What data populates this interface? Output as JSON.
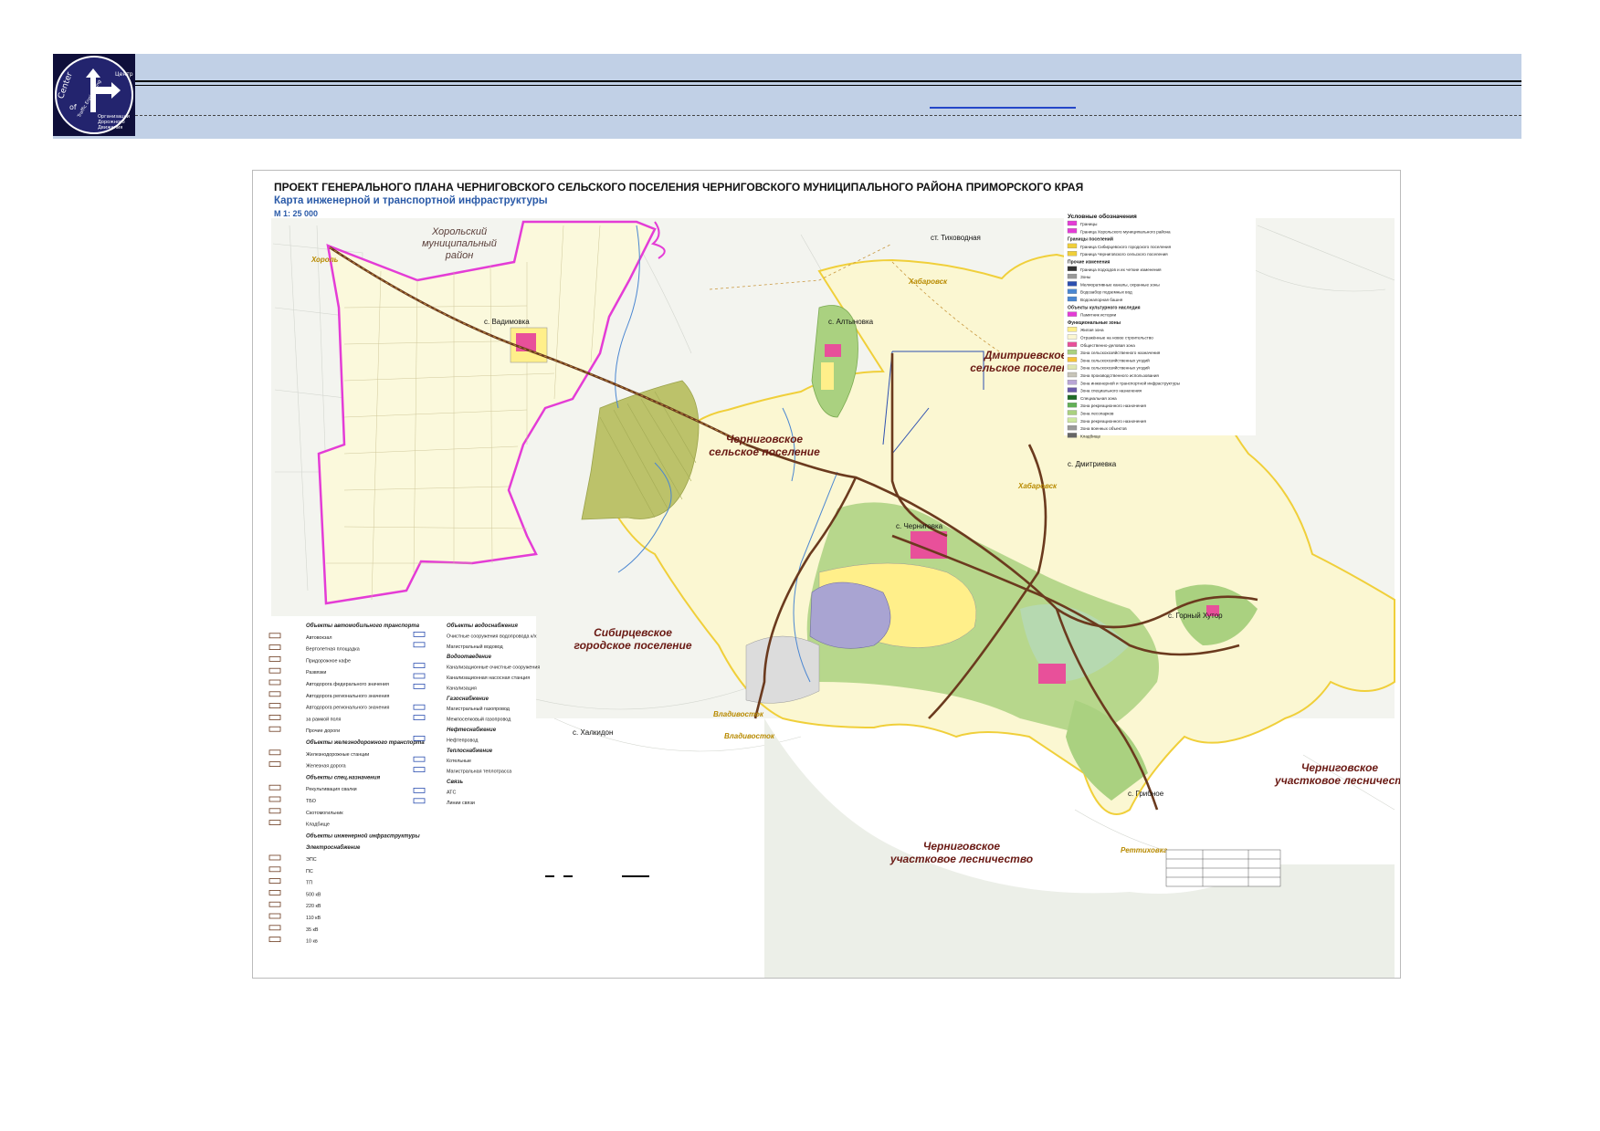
{
  "header": {
    "logo": {
      "text_center": "Center",
      "text_of": "of",
      "text_traffic": "Traffic Engineering",
      "text_centr": "Центр",
      "text_org1": "Организации",
      "text_org2": "Дорожного",
      "text_org3": "Движения"
    }
  },
  "map": {
    "title": "ПРОЕКТ ГЕНЕРАЛЬНОГО ПЛАНА ЧЕРНИГОВСКОГО СЕЛЬСКОГО ПОСЕЛЕНИЯ ЧЕРНИГОВСКОГО МУНИЦИПАЛЬНОГО РАЙОНА ПРИМОРСКОГО КРАЯ",
    "subtitle": "Карта инженерной и транспортной инфраструктуры",
    "scale": "М 1: 25 000",
    "regions": [
      {
        "id": "khorol",
        "lines": [
          "Хорольский",
          "муниципальный",
          "район"
        ]
      },
      {
        "id": "dmitr",
        "lines": [
          "Дмитриевское",
          "сельское поселение"
        ]
      },
      {
        "id": "chern",
        "lines": [
          "Черниговское",
          "сельское поселение"
        ]
      },
      {
        "id": "sibir",
        "lines": [
          "Сибирцевское",
          "городское поселение"
        ]
      },
      {
        "id": "lesn1",
        "lines": [
          "Черниговское",
          "участковое лесничество"
        ]
      },
      {
        "id": "lesn2",
        "lines": [
          "Черниговское",
          "участковое лесничест"
        ]
      }
    ],
    "settlements": {
      "vadimovka": "с. Вадимовка",
      "altynovka": "с. Алтыновка",
      "tikhovodnaya": "ст. Тиховодная",
      "chernigovka": "с. Черниговка",
      "dmitrievka": "с. Дмитриевка",
      "gorny": "с. Горный Хутор",
      "khalkidon": "с. Халкидон",
      "gribnoe": "с. Грибное"
    },
    "road_labels": {
      "khorol": "Хороль",
      "khab1": "Хабаровск",
      "khab2": "Хабаровск",
      "vlad1": "Владивосток",
      "vlad2": "Владивосток",
      "rettikhovka": "Реттиховка"
    },
    "legend_right": {
      "title": "Условные обозначения",
      "items": [
        "Границы",
        "Граница Хорольского муниципального района",
        "Границы поселений",
        "Граница Сибирцевского городского поселения",
        "Граница Черниговского сельского поселения",
        "Прочие изменения",
        "Граница подходов и их четкие изменения",
        "Зоны",
        "Мелиоративные каналы, охранные зоны",
        "Водозабор подземных вод",
        "Водонапорная башня",
        "Объекты культурного наследия",
        "Памятник истории",
        "Функциональные зоны",
        "Жилая зона",
        "Отражённые на новое строительство",
        "Общественно-деловая зона",
        "Зона сельскохозяйственного назначения",
        "Зона сельскохозяйственных угодий",
        "Зона сельскохозяйственных угодий",
        "Зона производственного использования",
        "Зона инженерной и транспортной инфраструктуры",
        "Зона специального назначения",
        "Специальная зона",
        "Зона рекреационного назначения",
        "Зона лесопарков",
        "Зона рекреационного назначения",
        "Зона военных объектов",
        "Кладбище"
      ]
    },
    "legend_left_col1": [
      {
        "h": true,
        "t": "Объекты автомобильного транспорта"
      },
      {
        "t": "Автовокзал"
      },
      {
        "t": "Вертолетная площадка"
      },
      {
        "t": "Придорожное кафе"
      },
      {
        "t": "Развязки"
      },
      {
        "t": "Автодорога федерального значения"
      },
      {
        "t": "Автодорога регионального значения"
      },
      {
        "t": "Автодорога регионального значения"
      },
      {
        "t": "за рамкой поля"
      },
      {
        "t": "Прочие дороги"
      },
      {
        "h": true,
        "t": "Объекты железнодорожного транспорта"
      },
      {
        "t": "Железнодорожные станции"
      },
      {
        "t": "Железная дорога"
      },
      {
        "h": true,
        "t": "Объекты спец.назначения"
      },
      {
        "t": "Рекультивация свалки"
      },
      {
        "t": "ТБО"
      },
      {
        "t": "Скотомогильник"
      },
      {
        "t": "Кладбище"
      },
      {
        "h": true,
        "t": "Объекты инженерной инфраструктуры"
      },
      {
        "h": true,
        "t": "Электроснабжение"
      },
      {
        "t": "ЭПС"
      },
      {
        "t": "ПС"
      },
      {
        "t": "ТП"
      },
      {
        "t": "500 кВ"
      },
      {
        "t": "220 кВ"
      },
      {
        "t": "110 кВ"
      },
      {
        "t": "35 кВ"
      },
      {
        "t": "10 кв"
      }
    ],
    "legend_left_col2": [
      {
        "h": true,
        "t": "Объекты водоснабжения"
      },
      {
        "t": "Очистные сооружения водопровода к/х"
      },
      {
        "t": "Магистральный водовод"
      },
      {
        "h": true,
        "t": "Водоотведение"
      },
      {
        "t": "Канализационные очистные сооружения"
      },
      {
        "t": "Канализационная насосная станция"
      },
      {
        "t": "Канализация"
      },
      {
        "h": true,
        "t": "Газоснабжение"
      },
      {
        "t": "Магистральный газопровод"
      },
      {
        "t": "Межпоселковый газопровод"
      },
      {
        "h": true,
        "t": "Нефтеснабжение"
      },
      {
        "t": "Нефтепровод"
      },
      {
        "h": true,
        "t": "Теплоснабжение"
      },
      {
        "t": "Котельные"
      },
      {
        "t": "Магистральная теплотрасса"
      },
      {
        "h": true,
        "t": "Связь"
      },
      {
        "t": "АТС"
      },
      {
        "t": "Линии связи"
      }
    ]
  },
  "colors": {
    "header_band": "#c1d0e6",
    "settlement_zone": "#fbf7d2",
    "forest": "#e8eee4",
    "khorol_boundary": "#e43cd6",
    "chern_boundary": "#f0cf3a",
    "green_zone": "#aad180",
    "olive_forest": "#b9c25f",
    "residential": "#ffef8a",
    "public": "#e8509a",
    "industrial": "#a9a4d2",
    "road": "#6b3a1e",
    "label_dark_red": "#6a1a14"
  }
}
